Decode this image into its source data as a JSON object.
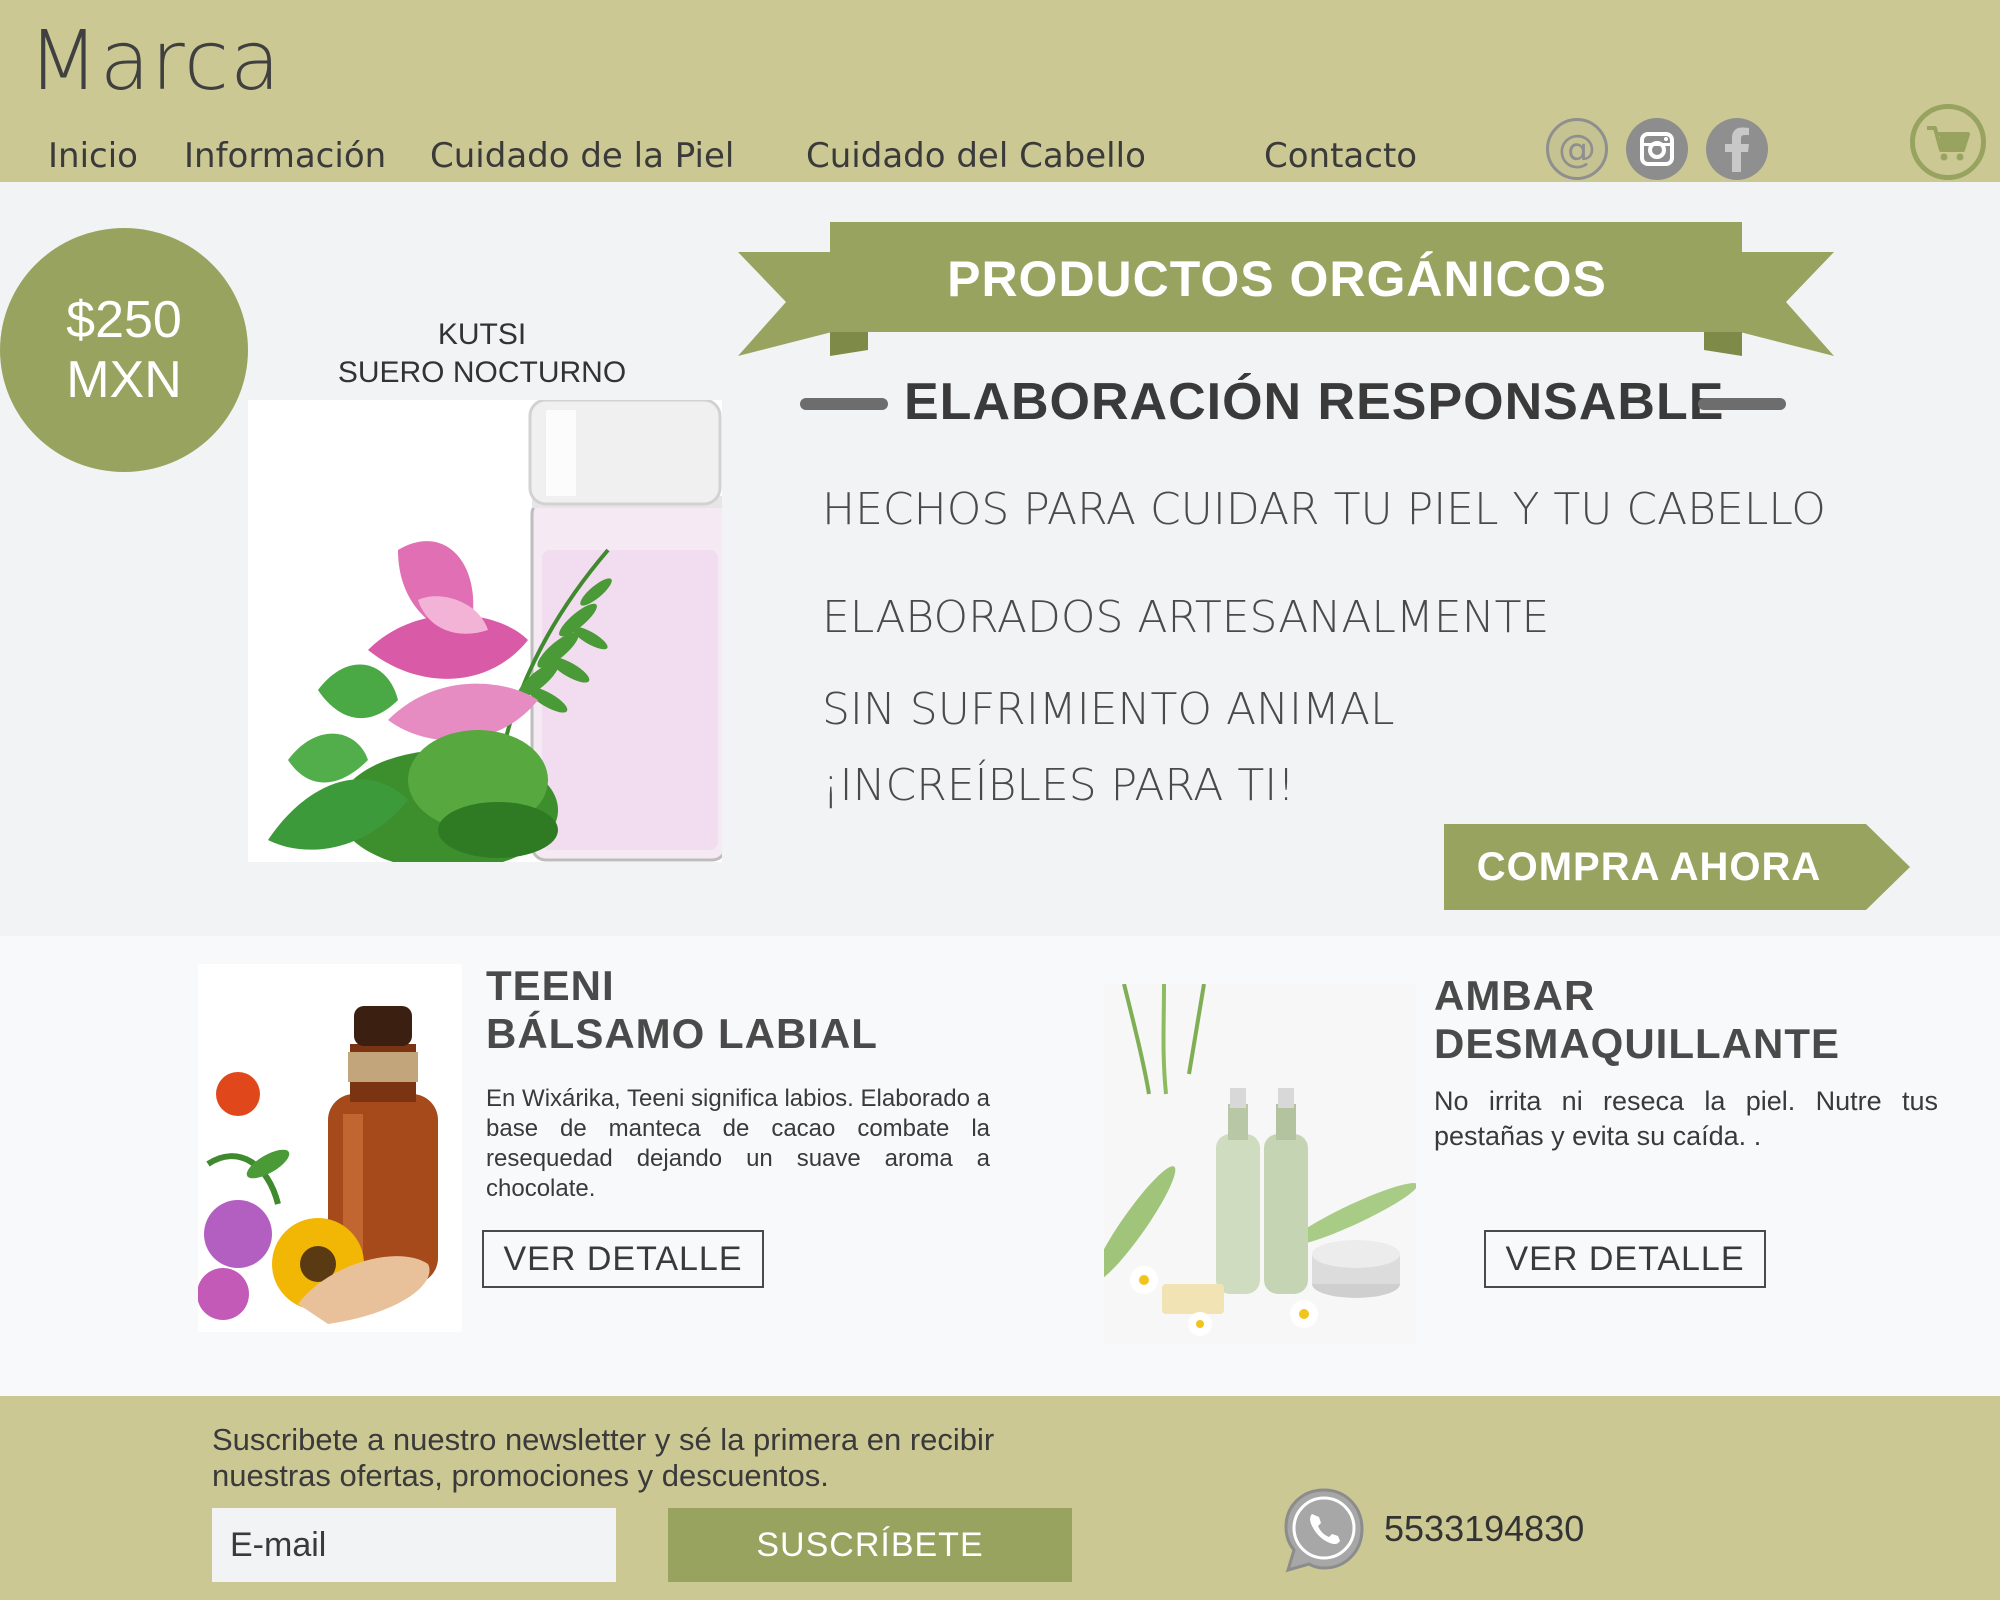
{
  "header": {
    "brand": "Marca",
    "nav": [
      {
        "label": "Inicio"
      },
      {
        "label": "Información"
      },
      {
        "label": "Cuidado de la Piel"
      },
      {
        "label": "Cuidado del Cabello"
      },
      {
        "label": "Contacto"
      }
    ],
    "social": [
      "email-icon",
      "instagram-icon",
      "facebook-icon"
    ],
    "cart_icon": "cart-icon"
  },
  "hero": {
    "price_line1": "$250",
    "price_line2": "MXN",
    "featured_name_line1": "KUTSI",
    "featured_name_line2": "SUERO NOCTURNO",
    "banner": "PRODUCTOS ORGÁNICOS",
    "subtitle": "ELABORACIÓN RESPONSABLE",
    "lines": [
      "HECHOS PARA CUIDAR TU PIEL Y  TU CABELLO",
      "ELABORADOS ARTESANALMENTE",
      "SIN SUFRIMIENTO ANIMAL",
      "¡INCREÍBLES PARA TI!"
    ],
    "cta": "COMPRA AHORA"
  },
  "products": [
    {
      "title_line1": "TEENI",
      "title_line2": "BÁLSAMO LABIAL",
      "description": "En Wixárika, Teeni significa labios. Elaborado a base de manteca de cacao combate la resequedad dejando un suave aroma a chocolate.",
      "button": "VER DETALLE"
    },
    {
      "title_line1": "AMBAR",
      "title_line2": "DESMAQUILLANTE",
      "description": "No irrita ni reseca la piel. Nutre  tus pestañas  y  evita  su  caída.         .",
      "button": "VER DETALLE"
    }
  ],
  "footer": {
    "newsletter_line1": "Suscribete a nuestro newsletter y sé la primera en recibir",
    "newsletter_line2": "nuestras ofertas, promociones y descuentos.",
    "email_placeholder": "E-mail",
    "subscribe": "SUSCRÍBETE",
    "phone": "5533194830",
    "phone_icon": "whatsapp-icon"
  },
  "colors": {
    "header_bg": "#cbc894",
    "accent": "#97a35f",
    "hero_bg": "#f2f3f5",
    "text": "#3d3d3d"
  }
}
